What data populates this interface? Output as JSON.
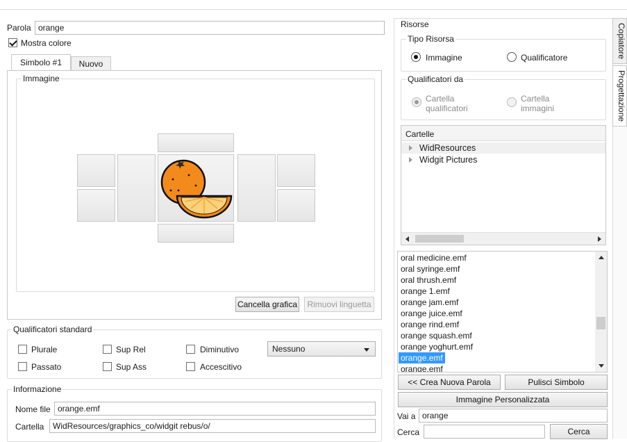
{
  "word": {
    "label": "Parola",
    "value": "orange"
  },
  "show_color": {
    "label": "Mostra colore",
    "checked": true
  },
  "symbol_tabs": [
    {
      "label": "Simbolo #1",
      "active": true
    },
    {
      "label": "Nuovo",
      "active": false
    }
  ],
  "image_group": {
    "title": "Immagine"
  },
  "image_buttons": {
    "clear": "Cancella grafica",
    "remove_tab": "Rimuovi linguetta"
  },
  "qualifiers": {
    "title": "Qualificatori standard",
    "items": [
      "Plurale",
      "Sup Rel",
      "Diminutivo",
      "Passato",
      "Sup Ass",
      "Accescitivo"
    ],
    "select_value": "Nessuno"
  },
  "info": {
    "title": "Informazione",
    "filename_label": "Nome file",
    "filename_value": "orange.emf",
    "folder_label": "Cartella",
    "folder_value": "WidResources/graphics_co/widgit rebus/o/"
  },
  "resources": {
    "title": "Risorse",
    "type_group": "Tipo Risorsa",
    "type_image": "Immagine",
    "type_qualifier": "Qualificatore",
    "qualifiers_from": "Qualificatori da",
    "folder_qualifiers": [
      "Cartella",
      "qualificatori"
    ],
    "folder_images": [
      "Cartella",
      "immagini"
    ],
    "folders_header": "Cartelle",
    "folders": [
      "WidResources",
      "Widgit Pictures"
    ],
    "files": [
      "oral medicine.emf",
      "oral syringe.emf",
      "oral thrush.emf",
      "orange 1.emf",
      "orange jam.emf",
      "orange juice.emf",
      "orange rind.emf",
      "orange squash.emf",
      "orange yoghurt.emf",
      "orange.emf",
      "orange.emf"
    ],
    "selected_file_index": 9,
    "new_word_button": "<< Crea Nuova Parola",
    "clear_symbol_button": "Pulisci Simbolo",
    "custom_image_button": "Immagine Personalizzata",
    "goto_label": "Vai a",
    "goto_value": "orange",
    "search_label": "Cerca",
    "search_value": "",
    "search_button": "Cerca"
  },
  "side_tabs": [
    "Copiatore",
    "Progettazione"
  ],
  "colors": {
    "selection": "#3399ff",
    "orange": "#f38a1c",
    "slot": "#ececec"
  }
}
